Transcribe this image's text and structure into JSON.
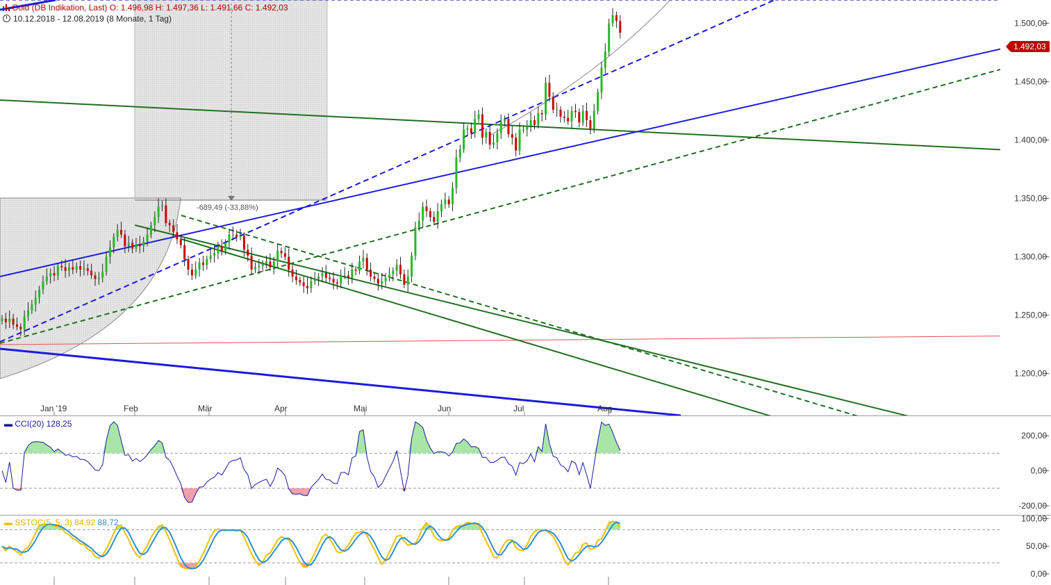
{
  "header": {
    "instrument": "Gold (DB Indikation, Last)",
    "ohlc": "O: 1.496,98  H: 1.497,36  L: 1.491,66  C: 1.492,03",
    "range": "10.12.2018 - 12.08.2019",
    "period": "(8 Monate, 1 Tag)"
  },
  "price_tag": "1.492,03",
  "measure_label": "-689,49 (-33,88%)",
  "cci": {
    "label": "CCI(20)",
    "value": "128,25"
  },
  "sstoc": {
    "label": "SSTOC(5, 5, 3)",
    "k": "84,92",
    "d": "88,72"
  },
  "colors": {
    "up": "#22bb22",
    "down": "#d00000",
    "trend_blue": "#1a1adf",
    "trend_green": "#1f6f1f",
    "level_red": "#e05050",
    "stoch_k": "#f0c000",
    "stoch_d": "#2a8fd0"
  },
  "chart_data": {
    "type": "candlestick",
    "price_axis": {
      "ticks": [
        "1.200,00",
        "1.250,00",
        "1.300,00",
        "1.350,00",
        "1.400,00",
        "1.450,00",
        "1.500,00"
      ],
      "ylim": [
        1164,
        1520
      ]
    },
    "x_ticks": [
      "Jan '19",
      "Feb",
      "Mär",
      "Apr",
      "Mai",
      "Jun",
      "Jul",
      "Aug"
    ],
    "closes": [
      1247,
      1244,
      1247,
      1242,
      1240,
      1238,
      1249,
      1254,
      1259,
      1265,
      1272,
      1279,
      1283,
      1286,
      1284,
      1292,
      1291,
      1288,
      1291,
      1289,
      1292,
      1289,
      1290,
      1288,
      1284,
      1281,
      1282,
      1287,
      1300,
      1308,
      1317,
      1323,
      1319,
      1309,
      1312,
      1307,
      1311,
      1309,
      1313,
      1319,
      1327,
      1334,
      1343,
      1344,
      1329,
      1327,
      1321,
      1315,
      1310,
      1298,
      1289,
      1284,
      1289,
      1295,
      1293,
      1298,
      1301,
      1303,
      1309,
      1305,
      1312,
      1319,
      1319,
      1317,
      1318,
      1306,
      1301,
      1289,
      1291,
      1292,
      1294,
      1296,
      1291,
      1296,
      1305,
      1303,
      1300,
      1289,
      1283,
      1280,
      1278,
      1275,
      1273,
      1279,
      1281,
      1283,
      1286,
      1282,
      1281,
      1278,
      1277,
      1284,
      1284,
      1282,
      1289,
      1288,
      1296,
      1299,
      1289,
      1283,
      1281,
      1277,
      1279,
      1282,
      1285,
      1288,
      1293,
      1285,
      1276,
      1283,
      1301,
      1325,
      1331,
      1343,
      1339,
      1334,
      1330,
      1339,
      1345,
      1349,
      1345,
      1359,
      1385,
      1392,
      1409,
      1410,
      1406,
      1418,
      1422,
      1402,
      1407,
      1396,
      1398,
      1406,
      1416,
      1418,
      1405,
      1402,
      1391,
      1409,
      1409,
      1412,
      1417,
      1413,
      1423,
      1422,
      1449,
      1437,
      1426,
      1426,
      1420,
      1419,
      1416,
      1425,
      1424,
      1415,
      1425,
      1417,
      1410,
      1425,
      1441,
      1462,
      1476,
      1500,
      1507,
      1502,
      1492
    ],
    "cci": {
      "ticks": [
        "200,00",
        "0,00",
        "-200,00"
      ],
      "ylim": [
        -240,
        300
      ],
      "levels": [
        100,
        -100
      ]
    },
    "sstoc": {
      "ticks": [
        "100,00",
        "50,00",
        "0,00"
      ],
      "ylim": [
        -5,
        103
      ],
      "levels": [
        80,
        20
      ]
    }
  }
}
